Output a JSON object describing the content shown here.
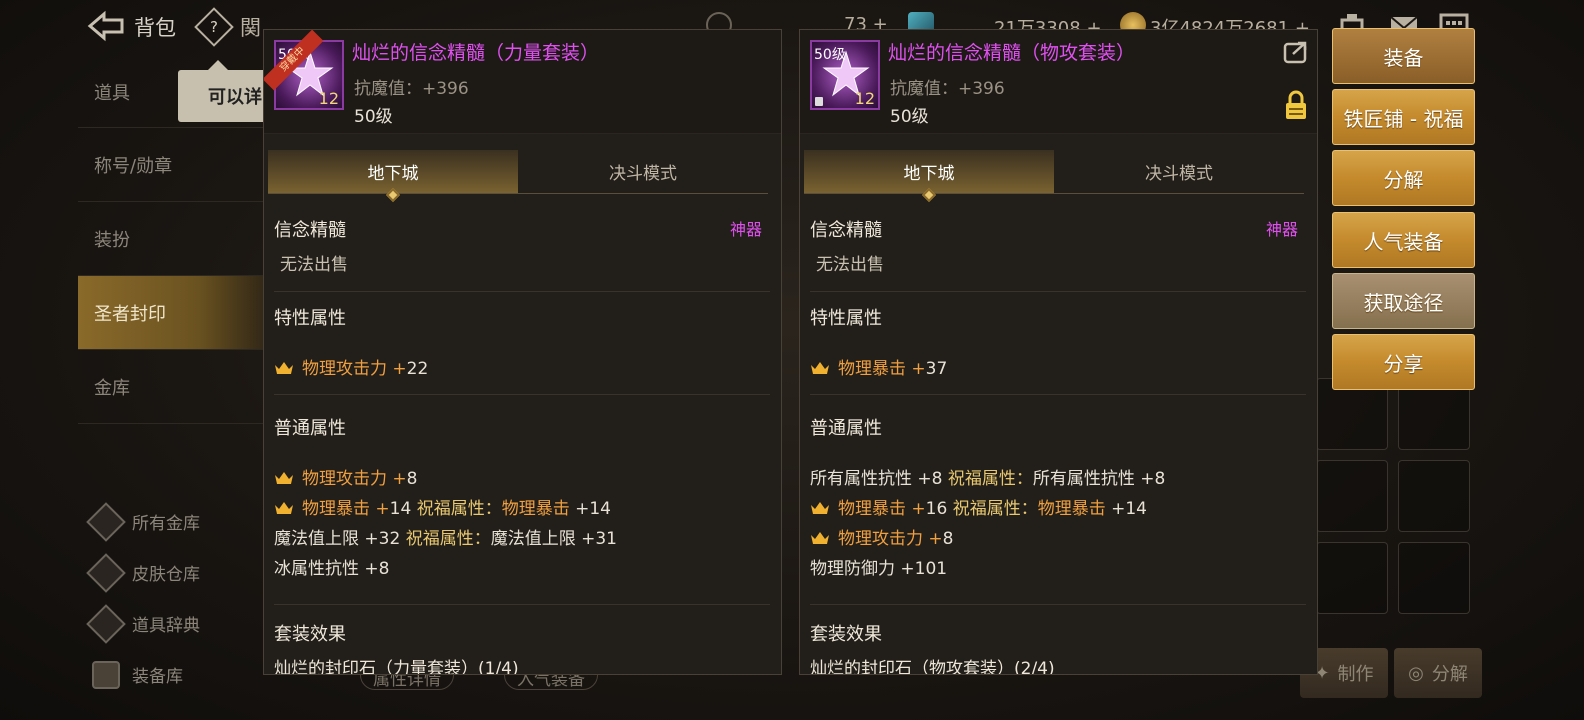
{
  "topbar": {
    "title": "背包",
    "help": "?",
    "cut_text": "関",
    "currency1": "73",
    "currency2": "21万3308",
    "currency3": "3亿4824万2681",
    "plus": "+"
  },
  "sidebar": {
    "items": [
      {
        "label": "道具"
      },
      {
        "label": "称号/勋章"
      },
      {
        "label": "装扮"
      },
      {
        "label": "圣者封印"
      },
      {
        "label": "金库"
      }
    ],
    "tooltip": "可以详",
    "storage": [
      {
        "label": "所有金库"
      },
      {
        "label": "皮肤仓库"
      },
      {
        "label": "道具辞典"
      },
      {
        "label": "装备库"
      }
    ]
  },
  "bottom": {
    "make": "制作",
    "decompose": "分解",
    "under1": "属性详情",
    "under2": "入气装备"
  },
  "panel_left": {
    "level_badge": "50级",
    "ribbon": "穿戴中",
    "count": "12",
    "name": "灿烂的信念精髓（力量套装）",
    "sub": "抗魔值：+396",
    "level": "50级",
    "tabs": [
      "地下城",
      "决斗模式"
    ],
    "category": "信念精髓",
    "divine": "神器",
    "unsellable": "无法出售",
    "trait_title": "特性属性",
    "trait": {
      "name": "物理攻击力",
      "plus": "+",
      "value": "22"
    },
    "normal_title": "普通属性",
    "normal": [
      {
        "crown": true,
        "name": "物理攻击力",
        "plus": "+",
        "value": "8",
        "bless_label": "",
        "bless_name": "",
        "bless_value": ""
      },
      {
        "crown": true,
        "name": "物理暴击",
        "plus": "+",
        "value": "14",
        "bless_label": "祝福属性：",
        "bless_name": "物理暴击",
        "bless_value": "+14"
      },
      {
        "crown": false,
        "name": "魔法值上限",
        "plus": "+",
        "value": "32",
        "bless_label": "祝福属性：",
        "bless_name": "魔法值上限",
        "bless_value": "+31"
      },
      {
        "crown": false,
        "name": "冰属性抗性",
        "plus": "+",
        "value": "8",
        "bless_label": "",
        "bless_name": "",
        "bless_value": ""
      }
    ],
    "set_title": "套装效果",
    "set_line": "灿烂的封印石（力量套装）(1/4)"
  },
  "panel_right": {
    "level_badge": "50级",
    "count": "12",
    "name": "灿烂的信念精髓（物攻套装）",
    "sub": "抗魔值：+396",
    "level": "50级",
    "tabs": [
      "地下城",
      "决斗模式"
    ],
    "category": "信念精髓",
    "divine": "神器",
    "unsellable": "无法出售",
    "trait_title": "特性属性",
    "trait": {
      "name": "物理暴击",
      "plus": "+",
      "value": "37"
    },
    "normal_title": "普通属性",
    "normal": [
      {
        "crown": false,
        "name": "所有属性抗性",
        "plus": "+",
        "value": "8",
        "bless_label": "祝福属性：",
        "bless_name": "所有属性抗性",
        "bless_value": "+8"
      },
      {
        "crown": true,
        "name": "物理暴击",
        "plus": "+",
        "value": "16",
        "bless_label": "祝福属性：",
        "bless_name": "物理暴击",
        "bless_value": "+14"
      },
      {
        "crown": true,
        "name": "物理攻击力",
        "plus": "+",
        "value": "8",
        "bless_label": "",
        "bless_name": "",
        "bless_value": ""
      },
      {
        "crown": false,
        "name": "物理防御力",
        "plus": "+",
        "value": "101",
        "bless_label": "",
        "bless_name": "",
        "bless_value": ""
      }
    ],
    "set_title": "套装效果",
    "set_line": "灿烂的封印石（物攻套装）(2/4)"
  },
  "actions": [
    {
      "label": "装备"
    },
    {
      "label": "铁匠铺 - 祝福"
    },
    {
      "label": "分解"
    },
    {
      "label": "人气装备"
    },
    {
      "label": "获取途径"
    },
    {
      "label": "分享"
    }
  ],
  "colors": {
    "item_name": "#e050f0",
    "stat_orange": "#f0a040",
    "bless_gold": "#e8c870",
    "button_gold": "#c48a2c"
  },
  "icons": [
    "back-arrow-icon",
    "help-icon",
    "coin-icon",
    "gem-icon",
    "gold-coin-icon",
    "mail-icon",
    "menu-icon",
    "crown-icon",
    "share-icon",
    "lock-icon",
    "star-icon"
  ]
}
